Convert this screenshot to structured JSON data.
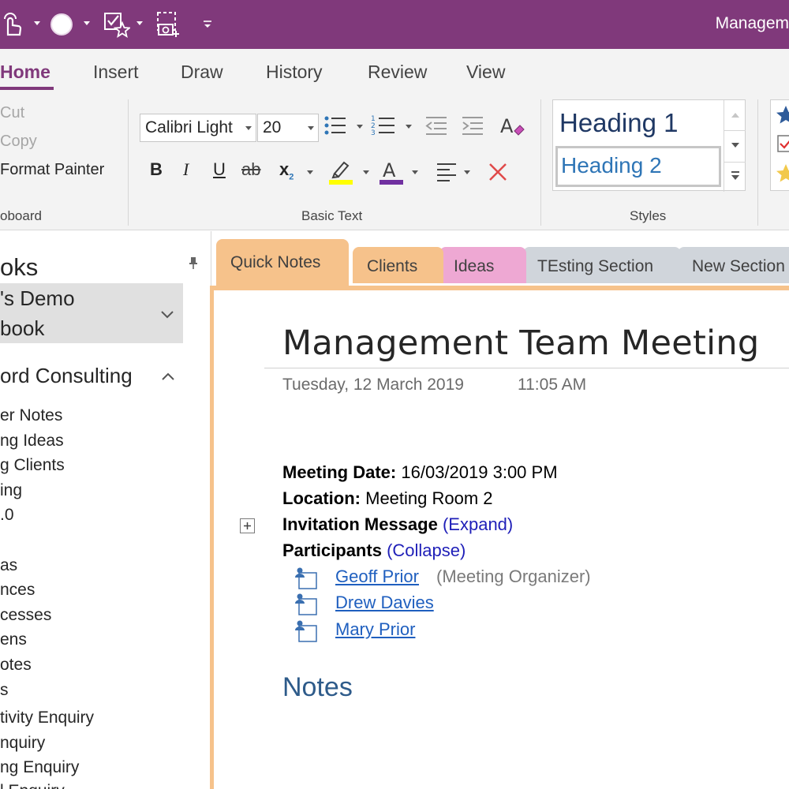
{
  "app": {
    "title": "Managem",
    "accent_color": "#80397b"
  },
  "quick_access": [
    {
      "icon": "touch-mode-icon"
    },
    {
      "icon": "circle-icon"
    },
    {
      "icon": "tag-checkbox-star-icon"
    },
    {
      "icon": "screen-clipping-icon"
    },
    {
      "icon": "customize-toolbar-icon"
    }
  ],
  "ribbon_tabs": [
    {
      "label": "Home",
      "active": true
    },
    {
      "label": "Insert"
    },
    {
      "label": "Draw"
    },
    {
      "label": "History"
    },
    {
      "label": "Review"
    },
    {
      "label": "View"
    }
  ],
  "clipboard": {
    "cut_label": "Cut",
    "copy_label": "Copy",
    "format_painter_label": "Format Painter",
    "group_label": "oboard"
  },
  "basic_text": {
    "font_name": "Calibri Light",
    "font_size": "20",
    "group_label": "Basic Text",
    "bold_label": "B",
    "italic_label": "I",
    "underline_label": "U",
    "strikethrough_label": "ab",
    "subscript_label": "x",
    "subscript_sub": "2",
    "font_color_label": "A",
    "highlight_color": "#ffff00",
    "font_color": "#7030a0",
    "clear_icon": "clear-formatting-icon"
  },
  "styles": {
    "heading1": "Heading 1",
    "heading2": "Heading 2",
    "group_label": "Styles"
  },
  "navigation": {
    "title": "oks",
    "notebook1_line1": "'s Demo",
    "notebook1_line2": "book",
    "notebook2": "ord Consulting",
    "sections": [
      "er Notes",
      "ng Ideas",
      "g Clients",
      "ing",
      ".0",
      "",
      "as",
      "nces",
      "cesses",
      "ens",
      "otes",
      "s",
      "tivity Enquiry",
      "nquiry",
      "ng Enquiry",
      "l Enquiry"
    ]
  },
  "section_tabs": [
    {
      "label": "Quick Notes",
      "color": "#f6c28b",
      "active": true
    },
    {
      "label": "Clients",
      "color": "#f6c28b"
    },
    {
      "label": "Ideas",
      "color": "#eea8d3"
    },
    {
      "label": "TEsting Section",
      "color": "#d0d5db"
    },
    {
      "label": "New Section",
      "color": "#d0d5db"
    }
  ],
  "page": {
    "title": "Management Team Meeting",
    "date": "Tuesday, 12 March 2019",
    "time": "11:05 AM",
    "meeting_date_label": "Meeting Date:",
    "meeting_date_value": "16/03/2019 3:00 PM",
    "location_label": "Location:",
    "location_value": "Meeting Room 2",
    "invitation_label": "Invitation Message",
    "invitation_action": "(Expand)",
    "participants_label": "Participants",
    "participants_action": "(Collapse)",
    "expander_symbol": "+",
    "participants": [
      {
        "name": "Geoff Prior ",
        "role": "(Meeting Organizer)"
      },
      {
        "name": "Drew Davies",
        "role": ""
      },
      {
        "name": "Mary Prior",
        "role": ""
      }
    ],
    "notes_heading": "Notes"
  }
}
